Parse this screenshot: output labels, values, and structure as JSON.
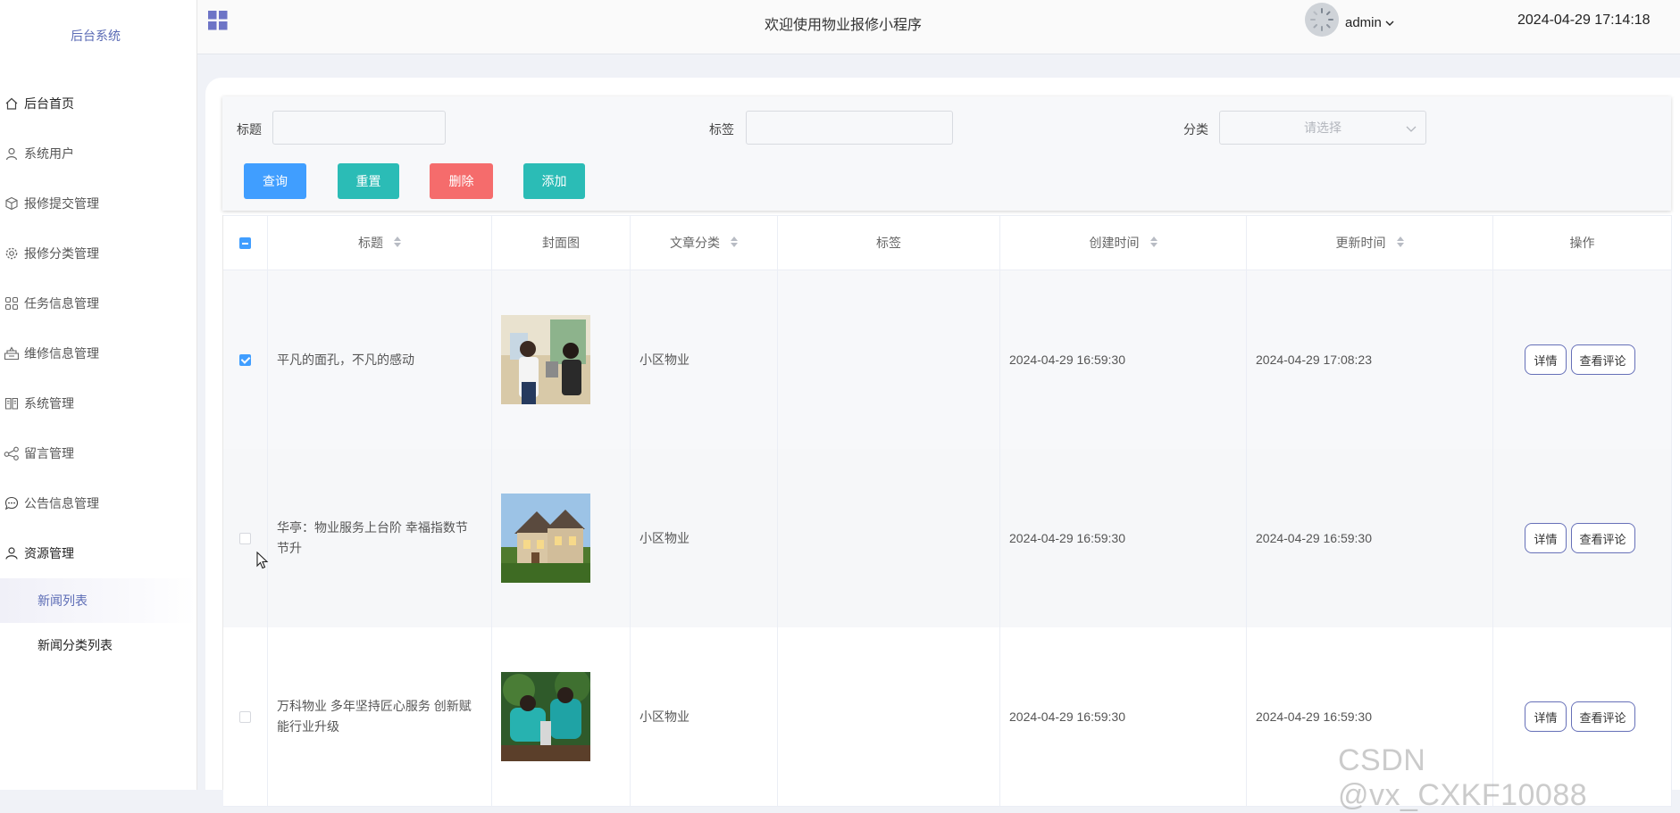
{
  "brand": "后台系统",
  "header": {
    "welcome": "欢迎使用物业报修小程序",
    "user": "admin",
    "datetime": "2024-04-29 17:14:18"
  },
  "sidebar": {
    "items": [
      {
        "label": "后台首页",
        "icon": "home-icon"
      },
      {
        "label": "系统用户",
        "icon": "user-icon"
      },
      {
        "label": "报修提交管理",
        "icon": "cube-icon"
      },
      {
        "label": "报修分类管理",
        "icon": "gear-icon"
      },
      {
        "label": "任务信息管理",
        "icon": "grid-icon"
      },
      {
        "label": "维修信息管理",
        "icon": "tray-icon"
      },
      {
        "label": "系统管理",
        "icon": "book-icon"
      },
      {
        "label": "留言管理",
        "icon": "share-icon"
      },
      {
        "label": "公告信息管理",
        "icon": "chat-icon"
      },
      {
        "label": "资源管理",
        "icon": "person-icon"
      }
    ],
    "subitems": [
      {
        "label": "新闻列表",
        "active": true
      },
      {
        "label": "新闻分类列表",
        "active": false
      }
    ]
  },
  "search": {
    "title_label": "标题",
    "tag_label": "标签",
    "category_label": "分类",
    "category_placeholder": "请选择",
    "buttons": {
      "query": "查询",
      "reset": "重置",
      "delete": "删除",
      "add": "添加"
    }
  },
  "table": {
    "headers": {
      "title": "标题",
      "cover": "封面图",
      "category": "文章分类",
      "tags": "标签",
      "created": "创建时间",
      "updated": "更新时间",
      "actions": "操作"
    },
    "rows": [
      {
        "checked": true,
        "title": "平凡的面孔，不凡的感动",
        "category": "小区物业",
        "tags": "",
        "created": "2024-04-29 16:59:30",
        "updated": "2024-04-29 17:08:23"
      },
      {
        "checked": false,
        "title": "华亭：物业服务上台阶 幸福指数节节升",
        "category": "小区物业",
        "tags": "",
        "created": "2024-04-29 16:59:30",
        "updated": "2024-04-29 16:59:30"
      },
      {
        "checked": false,
        "title": "万科物业 多年坚持匠心服务 创新赋能行业升级",
        "category": "小区物业",
        "tags": "",
        "created": "2024-04-29 16:59:30",
        "updated": "2024-04-29 16:59:30"
      }
    ],
    "row_actions": {
      "detail": "详情",
      "comments": "查看评论"
    }
  },
  "watermark": "CSDN @vx_CXKF10088",
  "colors": {
    "primary": "#409eff",
    "teal": "#2bbcb6",
    "danger": "#f56c6c",
    "accent": "#5b6bb5"
  }
}
